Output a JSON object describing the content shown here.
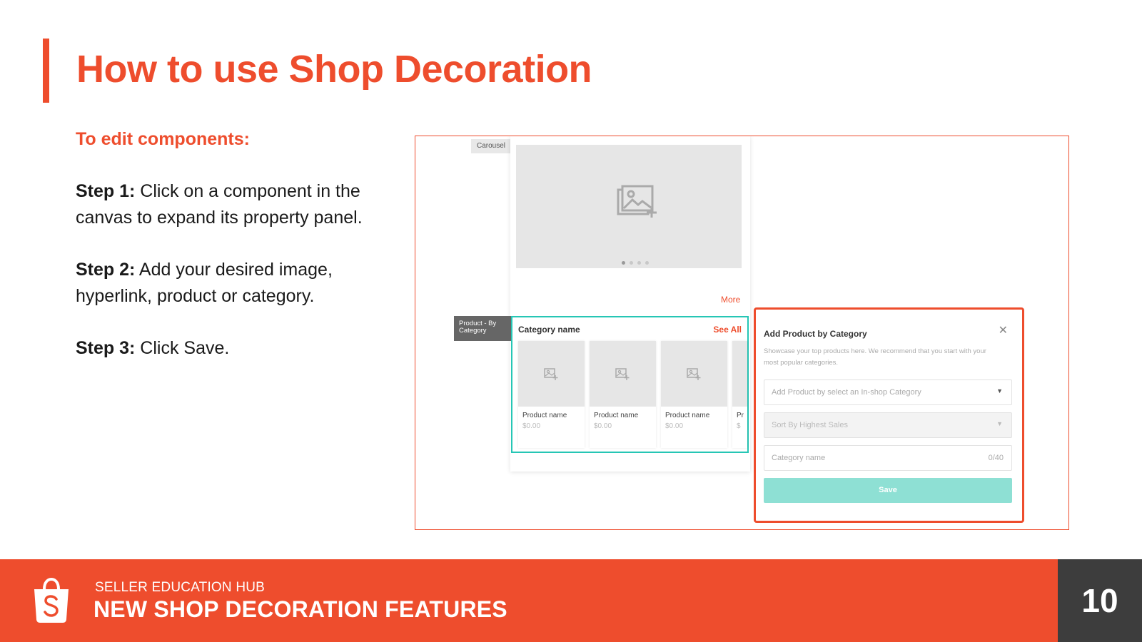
{
  "slide": {
    "title": "How to use Shop Decoration",
    "subtitle": "To edit components:",
    "steps": [
      {
        "label": "Step 1:",
        "text": " Click on a component in the canvas to expand its property panel."
      },
      {
        "label": "Step 2:",
        "text": " Add your desired image, hyperlink, product or category."
      },
      {
        "label": "Step 3:",
        "text": " Click Save."
      }
    ]
  },
  "screenshot": {
    "carousel_tag": "Carousel",
    "more_link": "More",
    "product_tag": "Product - By Category",
    "category_block": {
      "title": "Category name",
      "see_all": "See All",
      "products": [
        {
          "name": "Product name",
          "price": "$0.00"
        },
        {
          "name": "Product name",
          "price": "$0.00"
        },
        {
          "name": "Product name",
          "price": "$0.00"
        },
        {
          "name": "Pr",
          "price": "$"
        }
      ]
    },
    "panel": {
      "title": "Add Product by Category",
      "description": "Showcase your top products here. We recommend that you start with your most popular categories.",
      "category_select_placeholder": "Add Product by select an In-shop Category",
      "sort_select_value": "Sort By Highest Sales",
      "category_name_placeholder": "Category name",
      "category_name_counter": "0/40",
      "save_label": "Save"
    }
  },
  "footer": {
    "hub": "SELLER EDUCATION HUB",
    "title": "NEW SHOP DECORATION FEATURES",
    "page_number": "10"
  },
  "colors": {
    "brand": "#ee4d2d",
    "teal": "#26c6b5",
    "footer_dark": "#3d3d3d"
  },
  "icons": [
    "image-placeholder-icon",
    "close-icon",
    "caret-down-icon",
    "shopping-bag-icon"
  ]
}
